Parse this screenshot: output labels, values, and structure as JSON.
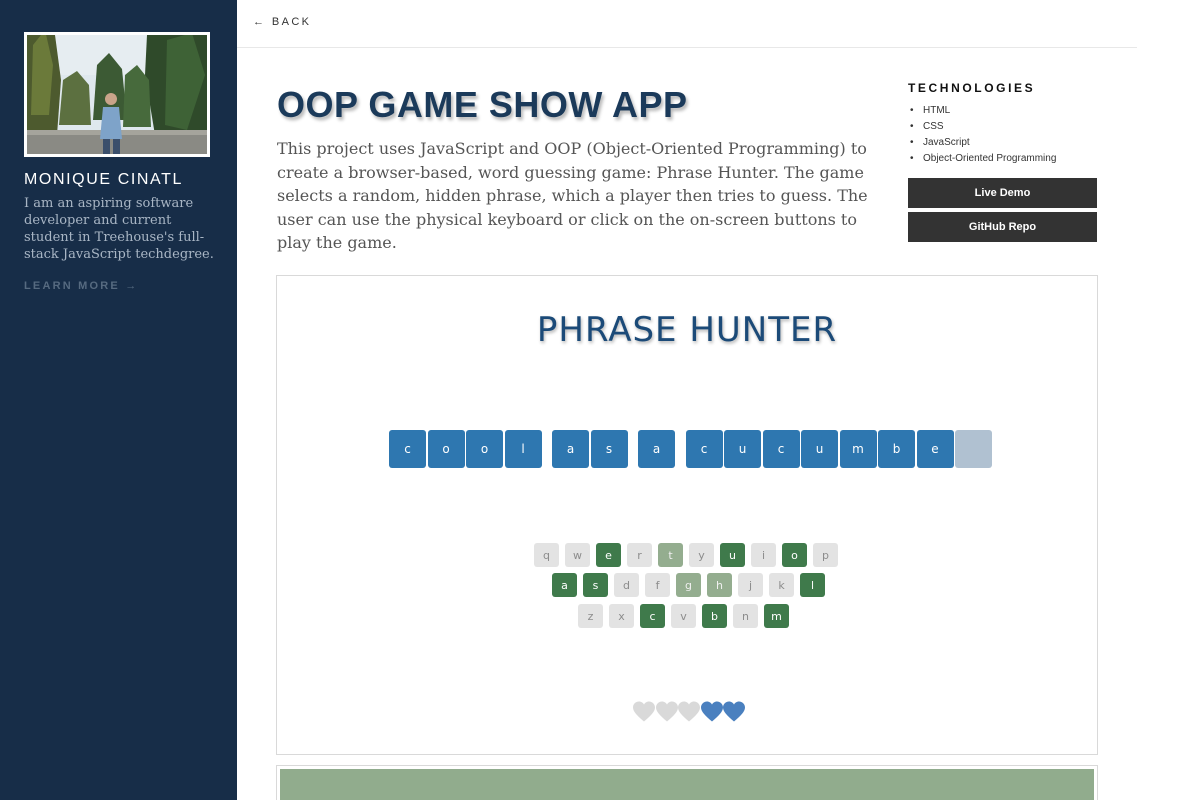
{
  "sidebar": {
    "author_name": "MONIQUE CINATL",
    "bio": "I am an aspiring software developer and current student in Treehouse's full-stack JavaScript techdegree.",
    "learn_more": "LEARN MORE →"
  },
  "topbar": {
    "back": "← BACK"
  },
  "project": {
    "title": "OOP GAME SHOW APP",
    "description": "This project uses JavaScript and OOP (Object-Oriented Programming) to create a browser-based, word guessing game: Phrase Hunter. The game selects a random, hidden phrase, which a player then tries to guess. The user can use the physical keyboard or click on the on-screen buttons to play the game.",
    "technologies_heading": "TECHNOLOGIES",
    "technologies": [
      "HTML",
      "CSS",
      "JavaScript",
      "Object-Oriented Programming"
    ],
    "live_demo": "Live Demo",
    "github_repo": "GitHub Repo"
  },
  "game": {
    "title": "PHRASE HUNTER",
    "phrase": [
      {
        "letter": "c",
        "state": "revealed"
      },
      {
        "letter": "o",
        "state": "revealed"
      },
      {
        "letter": "o",
        "state": "revealed"
      },
      {
        "letter": "l",
        "state": "revealed"
      },
      {
        "letter": "",
        "state": "space"
      },
      {
        "letter": "a",
        "state": "revealed"
      },
      {
        "letter": "s",
        "state": "revealed"
      },
      {
        "letter": "",
        "state": "space"
      },
      {
        "letter": "a",
        "state": "revealed"
      },
      {
        "letter": "",
        "state": "space"
      },
      {
        "letter": "c",
        "state": "revealed"
      },
      {
        "letter": "u",
        "state": "revealed"
      },
      {
        "letter": "c",
        "state": "revealed"
      },
      {
        "letter": "u",
        "state": "revealed"
      },
      {
        "letter": "m",
        "state": "revealed"
      },
      {
        "letter": "b",
        "state": "revealed"
      },
      {
        "letter": "e",
        "state": "revealed"
      },
      {
        "letter": "",
        "state": "hidden"
      }
    ],
    "keyboard": [
      [
        {
          "key": "q",
          "state": "default"
        },
        {
          "key": "w",
          "state": "default"
        },
        {
          "key": "e",
          "state": "chosen"
        },
        {
          "key": "r",
          "state": "default"
        },
        {
          "key": "t",
          "state": "wrong"
        },
        {
          "key": "y",
          "state": "default"
        },
        {
          "key": "u",
          "state": "chosen"
        },
        {
          "key": "i",
          "state": "default"
        },
        {
          "key": "o",
          "state": "chosen"
        },
        {
          "key": "p",
          "state": "default"
        }
      ],
      [
        {
          "key": "a",
          "state": "chosen"
        },
        {
          "key": "s",
          "state": "chosen"
        },
        {
          "key": "d",
          "state": "default"
        },
        {
          "key": "f",
          "state": "default"
        },
        {
          "key": "g",
          "state": "wrong"
        },
        {
          "key": "h",
          "state": "wrong"
        },
        {
          "key": "j",
          "state": "default"
        },
        {
          "key": "k",
          "state": "default"
        },
        {
          "key": "l",
          "state": "chosen"
        }
      ],
      [
        {
          "key": "z",
          "state": "default"
        },
        {
          "key": "x",
          "state": "default"
        },
        {
          "key": "c",
          "state": "chosen"
        },
        {
          "key": "v",
          "state": "default"
        },
        {
          "key": "b",
          "state": "chosen"
        },
        {
          "key": "n",
          "state": "default"
        },
        {
          "key": "m",
          "state": "chosen"
        }
      ]
    ],
    "lives": {
      "lost": 3,
      "remaining": 2,
      "colors": {
        "lost": "#d9d9d9",
        "remaining": "#4a80bf"
      }
    }
  },
  "colors": {
    "sidebar_bg": "#172d48",
    "tile_revealed": "#2e77b0",
    "tile_hidden": "#b0c1d1",
    "key_chosen": "#3f7a4b",
    "key_wrong": "#94ad8f",
    "button_bg": "#333333"
  }
}
